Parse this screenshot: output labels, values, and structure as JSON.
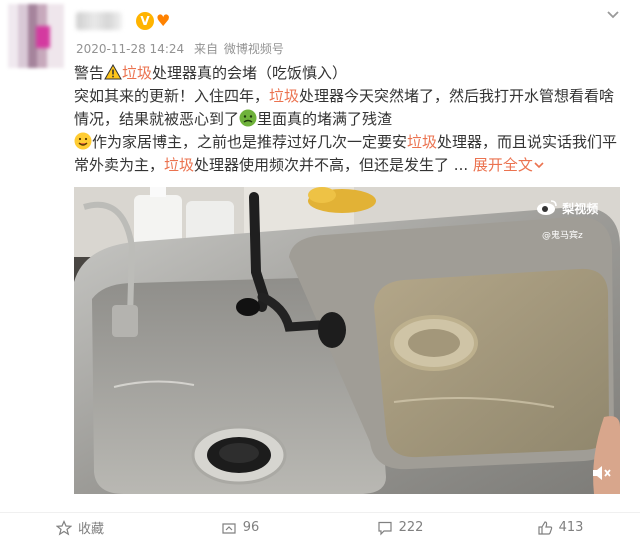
{
  "post": {
    "timestamp": "2020-11-28 14:24",
    "source_prefix": "来自",
    "source": "微博视频号",
    "line1_prefix": "警告",
    "line1_kw": "垃圾",
    "line1_rest": "处理器真的会堵（吃饭慎入）",
    "p2_a": "突如其来的更新！入住四年，",
    "p2_kw": "垃圾",
    "p2_b": "处理器今天突然堵了，然后我打开水管想看看啥情况，结果就被恶心到了",
    "p2_c": "里面真的堵满了残渣",
    "p3_a": "作为家居博主，之前也是推荐过好几次一定要安",
    "p3_kw": "垃圾",
    "p3_b": "处理器，而且说实话我们平常外卖为主，",
    "p3_kw2": "垃圾",
    "p3_c": "处理器使用频次并不高，但还是发生了 ...",
    "expand_label": "展开全文",
    "expand_icon": "chevron-down-icon"
  },
  "video": {
    "watermark": "梨视频",
    "watermark_sub": "@鬼马宾z"
  },
  "footer": {
    "favorite_label": "收藏",
    "repost_count": "96",
    "comment_count": "222",
    "like_count": "413"
  },
  "colors": {
    "keyword": "#eb7350",
    "meta": "#939393",
    "badge": "#ffb400"
  }
}
